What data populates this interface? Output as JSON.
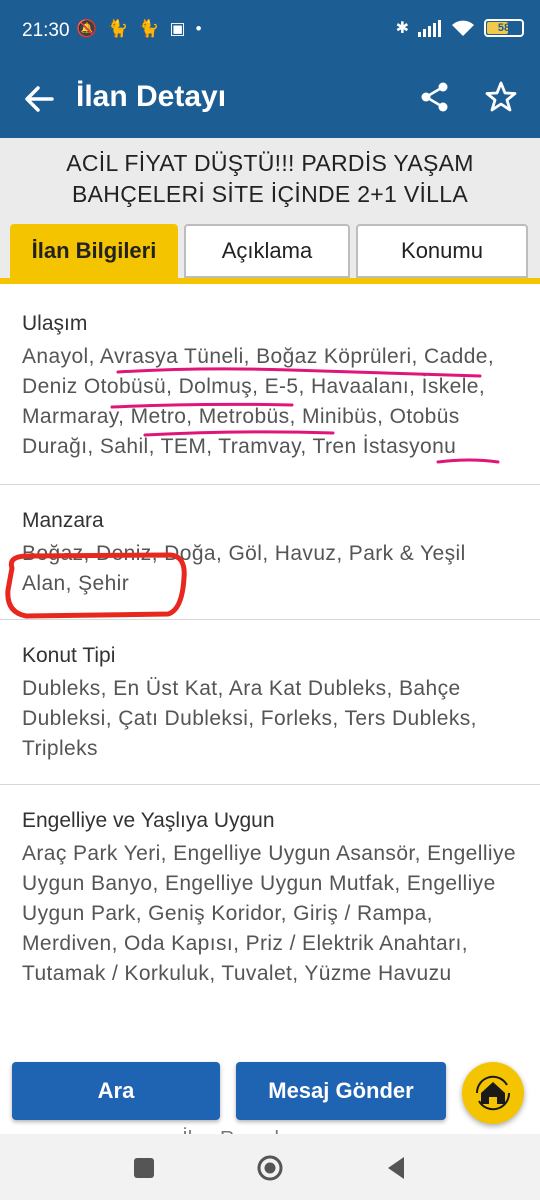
{
  "status_bar": {
    "time": "21:30",
    "battery": "58"
  },
  "app_bar": {
    "title": "İlan Detayı",
    "back_icon": "arrow-left-icon",
    "share_icon": "share-icon",
    "favorite_icon": "star-icon"
  },
  "listing": {
    "title": "ACİL FİYAT DÜŞTÜ!!! PARDİS YAŞAM BAHÇELERİ SİTE İÇİNDE 2+1 VİLLA"
  },
  "tabs": [
    {
      "label": "İlan Bilgileri",
      "active": true
    },
    {
      "label": "Açıklama",
      "active": false
    },
    {
      "label": "Konumu",
      "active": false
    }
  ],
  "sections": [
    {
      "title": "Ulaşım",
      "body": "Anayol, Avrasya Tüneli, Boğaz Köprüleri, Cadde, Deniz Otobüsü, Dolmuş, E-5, Havaalanı, İskele, Marmaray, Metro, Metrobüs, Minibüs, Otobüs Durağı, Sahil, TEM, Tramvay, Tren İstasyonu"
    },
    {
      "title": "Manzara",
      "body": "Boğaz, Deniz, Doğa, Göl, Havuz, Park & Yeşil Alan, Şehir"
    },
    {
      "title": "Konut Tipi",
      "body": "Dubleks, En Üst Kat, Ara Kat Dubleks, Bahçe Dubleksi, Çatı Dubleksi, Forleks, Ters Dubleks, Tripleks"
    },
    {
      "title": "Engelliye ve Yaşlıya Uygun",
      "body": "Araç Park Yeri, Engelliye Uygun Asansör, Engelliye Uygun Banyo, Engelliye Uygun Mutfak, Engelliye Uygun Park, Geniş Koridor, Giriş / Rampa, Merdiven, Oda Kapısı, Priz / Elektrik Anahtarı, Tutamak / Korkuluk, Tuvalet, Yüzme Havuzu"
    }
  ],
  "buttons": {
    "search": "Ara",
    "message": "Mesaj Gönder",
    "home_icon": "home-icon"
  },
  "colors": {
    "primary": "#1c5d94",
    "accent": "#f5c400",
    "button": "#1f63b3",
    "annotation_pink": "#e0157a",
    "annotation_red": "#e8281e"
  }
}
